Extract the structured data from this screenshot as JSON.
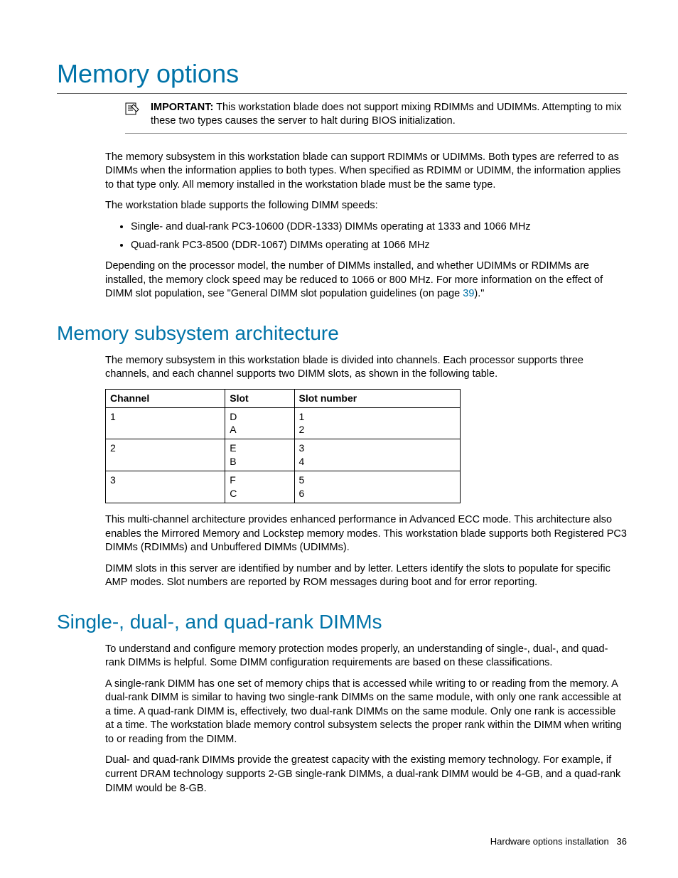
{
  "h1": "Memory options",
  "important": {
    "label": "IMPORTANT:",
    "text": "This workstation blade does not support mixing RDIMMs and UDIMMs. Attempting to mix these two types causes the server to halt during BIOS initialization."
  },
  "intro_p1": "The memory subsystem in this workstation blade can support RDIMMs or UDIMMs. Both types are referred to as DIMMs when the information applies to both types. When specified as RDIMM or UDIMM, the information applies to that type only. All memory installed in the workstation blade must be the same type.",
  "intro_p2": "The workstation blade supports the following DIMM speeds:",
  "bullets": [
    "Single- and dual-rank PC3-10600 (DDR-1333) DIMMs operating at 1333 and 1066 MHz",
    "Quad-rank PC3-8500 (DDR-1067) DIMMs operating at 1066 MHz"
  ],
  "intro_p3_a": "Depending on the processor model, the number of DIMMs installed, and whether UDIMMs or RDIMMs are installed, the memory clock speed may be reduced to 1066 or 800 MHz. For more information on the effect of DIMM slot population, see \"General DIMM slot population guidelines (on page ",
  "intro_p3_link": "39",
  "intro_p3_b": ").\"",
  "h2_arch": "Memory subsystem architecture",
  "arch_p1": "The memory subsystem in this workstation blade is divided into channels. Each processor supports three channels, and each channel supports two DIMM slots, as shown in the following table.",
  "table": {
    "headers": [
      "Channel",
      "Slot",
      "Slot number"
    ],
    "rows": [
      [
        "1",
        "D\nA",
        "1\n2"
      ],
      [
        "2",
        "E\nB",
        "3\n4"
      ],
      [
        "3",
        "F\nC",
        "5\n6"
      ]
    ]
  },
  "arch_p2": "This multi-channel architecture provides enhanced performance in Advanced ECC mode. This architecture also enables the Mirrored Memory and Lockstep memory modes. This workstation blade supports both Registered PC3 DIMMs (RDIMMs) and Unbuffered DIMMs (UDIMMs).",
  "arch_p3": "DIMM slots in this server are identified by number and by letter. Letters identify the slots to populate for specific AMP modes. Slot numbers are reported by ROM messages during boot and for error reporting.",
  "h2_rank": "Single-, dual-, and quad-rank DIMMs",
  "rank_p1": "To understand and configure memory protection modes properly, an understanding of single-, dual-, and quad-rank DIMMs is helpful. Some DIMM configuration requirements are based on these classifications.",
  "rank_p2": "A single-rank DIMM has one set of memory chips that is accessed while writing to or reading from the memory. A dual-rank DIMM is similar to having two single-rank DIMMs on the same module, with only one rank accessible at a time. A quad-rank DIMM is, effectively, two dual-rank DIMMs on the same module. Only one rank is accessible at a time. The workstation blade memory control subsystem selects the proper rank within the DIMM when writing to or reading from the DIMM.",
  "rank_p3": "Dual- and quad-rank DIMMs provide the greatest capacity with the existing memory technology. For example, if current DRAM technology supports 2-GB single-rank DIMMs, a dual-rank DIMM would be 4-GB, and a quad-rank DIMM would be 8-GB.",
  "footer_label": "Hardware options installation",
  "footer_page": "36"
}
